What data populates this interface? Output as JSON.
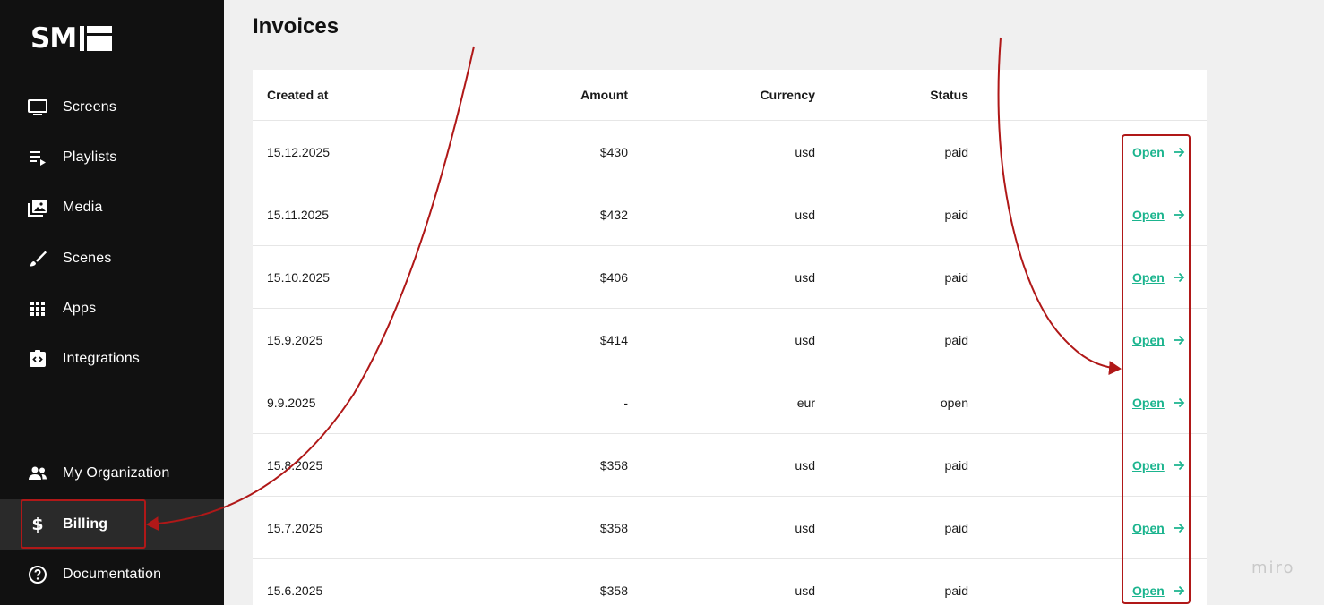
{
  "brand": {
    "logo_text": "SM"
  },
  "sidebar": {
    "items": [
      {
        "label": "Screens",
        "icon": "monitor-icon"
      },
      {
        "label": "Playlists",
        "icon": "playlist-icon"
      },
      {
        "label": "Media",
        "icon": "photo-library-icon"
      },
      {
        "label": "Scenes",
        "icon": "brush-icon"
      },
      {
        "label": "Apps",
        "icon": "grid-apps-icon"
      },
      {
        "label": "Integrations",
        "icon": "integration-icon"
      }
    ],
    "bottom_items": [
      {
        "label": "My Organization",
        "icon": "people-icon"
      },
      {
        "label": "Billing",
        "icon": "dollar-icon",
        "active": true
      },
      {
        "label": "Documentation",
        "icon": "help-circle-icon"
      }
    ]
  },
  "page": {
    "title": "Invoices"
  },
  "table": {
    "columns": [
      "Created at",
      "Amount",
      "Currency",
      "Status"
    ],
    "link_label": "Open",
    "rows": [
      {
        "created_at": "15.12.2025",
        "amount": "$430",
        "currency": "usd",
        "status": "paid"
      },
      {
        "created_at": "15.11.2025",
        "amount": "$432",
        "currency": "usd",
        "status": "paid"
      },
      {
        "created_at": "15.10.2025",
        "amount": "$406",
        "currency": "usd",
        "status": "paid"
      },
      {
        "created_at": "15.9.2025",
        "amount": "$414",
        "currency": "usd",
        "status": "paid"
      },
      {
        "created_at": "9.9.2025",
        "amount": "-",
        "currency": "eur",
        "status": "open"
      },
      {
        "created_at": "15.8.2025",
        "amount": "$358",
        "currency": "usd",
        "status": "paid"
      },
      {
        "created_at": "15.7.2025",
        "amount": "$358",
        "currency": "usd",
        "status": "paid"
      },
      {
        "created_at": "15.6.2025",
        "amount": "$358",
        "currency": "usd",
        "status": "paid"
      }
    ]
  },
  "watermark": {
    "text": "miro"
  },
  "colors": {
    "sidebar_bg": "#111111",
    "link": "#1bb48e",
    "annotation": "#b01818",
    "page_bg": "#f0f0f0"
  }
}
